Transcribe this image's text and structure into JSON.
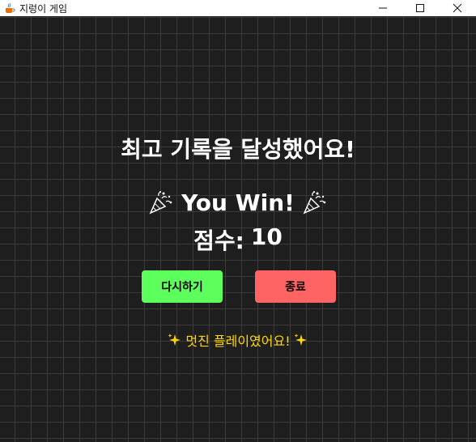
{
  "window": {
    "title": "지렁이 게임",
    "app_icon": "java-cup-icon",
    "controls": [
      "minimize-icon",
      "maximize-icon",
      "close-icon"
    ]
  },
  "game_over": {
    "headline": "최고 기록을 달성했어요!",
    "win_text": "You Win!",
    "win_icon": "party-popper-icon",
    "score_label": "점수:",
    "score_value": "10",
    "message": "멋진 플레이였어요!",
    "message_icon": "sparkles-icon"
  },
  "buttons": {
    "retry_label": "다시하기",
    "quit_label": "종료"
  },
  "colors": {
    "background": "#1e1e1e",
    "grid_line": "#3a3a3a",
    "retry_button": "#5dff5d",
    "quit_button": "#ff6464",
    "message_text": "#ffd700",
    "headline_text": "#ffffff"
  }
}
